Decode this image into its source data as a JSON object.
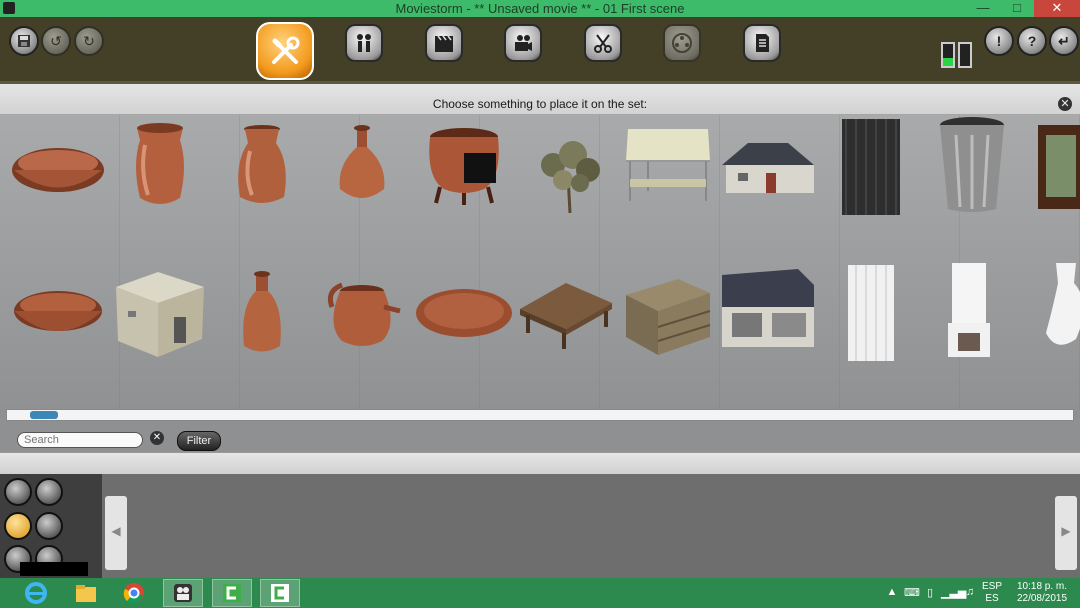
{
  "window": {
    "title": "Moviestorm - ** Unsaved movie ** - 01 First scene",
    "minimize_icon": "minimize-icon",
    "maximize_icon": "maximize-icon",
    "close_icon": "close-icon"
  },
  "toolbar": {
    "file_buttons": [
      "save-icon",
      "undo-icon",
      "redo-icon"
    ],
    "mode_buttons": [
      {
        "name": "set-dressing",
        "icon": "wrench-screwdriver-icon",
        "active": true
      },
      {
        "name": "cast",
        "icon": "people-icon",
        "active": false
      },
      {
        "name": "scenes",
        "icon": "clapperboard-icon",
        "active": false
      },
      {
        "name": "film",
        "icon": "camera-icon",
        "active": false
      },
      {
        "name": "edit",
        "icon": "scissors-icon",
        "active": false
      },
      {
        "name": "reel",
        "icon": "film-reel-icon",
        "active": false,
        "disabled": true
      },
      {
        "name": "publish",
        "icon": "document-icon",
        "active": false
      }
    ],
    "meters": [
      0.35,
      0.0
    ],
    "right_buttons": [
      "alert-icon",
      "help-icon",
      "back-icon"
    ]
  },
  "catalog": {
    "caption": "Choose something to place it on the set:",
    "close_icon": "close-icon",
    "row1": [
      "copper-bowl",
      "copper-vase",
      "copper-urn",
      "copper-bottle",
      "copper-cauldron",
      "shrub",
      "market-stall",
      "house",
      "mesh-curtain",
      "trash-can",
      "framed-picture"
    ],
    "row2": [
      "copper-bowl-2",
      "adobe-building",
      "copper-bottle-2",
      "copper-jug",
      "copper-plate",
      "wooden-table",
      "wooden-crate",
      "shop-building",
      "white-curtain",
      "fireplace",
      "white-vase"
    ],
    "scroll_position": 0.02
  },
  "search": {
    "placeholder": "Search",
    "clear_icon": "clear-icon",
    "filter_label": "Filter"
  },
  "left_tools": [
    "layout-icon",
    "scale-icon",
    "light-icon",
    "magic-icon",
    "rotate-icon",
    "cube-icon"
  ],
  "taskbar": {
    "apps": [
      "ie-icon",
      "file-explorer-icon",
      "chrome-icon",
      "moviestorm-icon",
      "camtasia-icon",
      "camtasia-recorder-icon"
    ],
    "tray_icons": [
      "chevron-up-icon",
      "keyboard-icon",
      "device-icon",
      "signal-icon",
      "volume-icon"
    ],
    "lang_top": "ESP",
    "lang_bottom": "ES",
    "time": "10:18 p. m.",
    "date": "22/08/2015"
  }
}
